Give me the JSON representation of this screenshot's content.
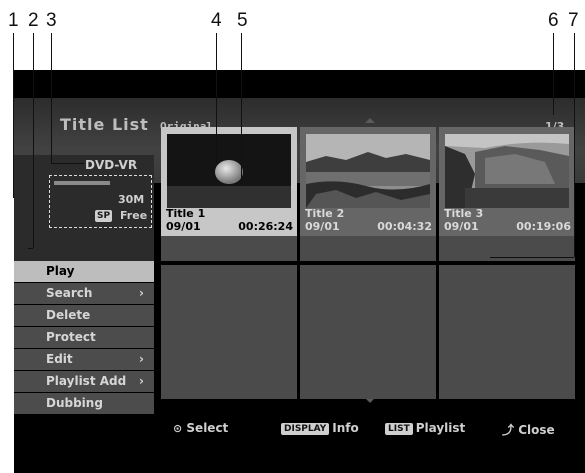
{
  "callouts": [
    "1",
    "2",
    "3",
    "4",
    "5",
    "6",
    "7"
  ],
  "header": {
    "title": "Title List",
    "mode": "Original",
    "page": "1/3"
  },
  "disc": {
    "type": "DVD-VR",
    "size": "30M",
    "sp_badge": "SP",
    "free": "Free"
  },
  "menu": {
    "items": [
      {
        "label": "Play",
        "active": true,
        "submenu": false
      },
      {
        "label": "Search",
        "active": false,
        "submenu": true
      },
      {
        "label": "Delete",
        "active": false,
        "submenu": false
      },
      {
        "label": "Protect",
        "active": false,
        "submenu": false
      },
      {
        "label": "Edit",
        "active": false,
        "submenu": true
      },
      {
        "label": "Playlist Add",
        "active": false,
        "submenu": true
      },
      {
        "label": "Dubbing",
        "active": false,
        "submenu": false
      }
    ],
    "submenu_arrow": "›"
  },
  "titles": [
    {
      "name": "Title 1",
      "date": "09/01",
      "duration": "00:26:24",
      "selected": true
    },
    {
      "name": "Title 2",
      "date": "09/01",
      "duration": "00:04:32",
      "selected": false
    },
    {
      "name": "Title 3",
      "date": "09/01",
      "duration": "00:19:06",
      "selected": false
    }
  ],
  "footer": {
    "select": "Select",
    "display_key": "DISPLAY",
    "info": "Info",
    "list_key": "LIST",
    "playlist": "Playlist",
    "close": "Close"
  },
  "colors": {
    "screen_bg": "#000000",
    "selected_bg": "#c7c7c7",
    "menu_bg": "#4c4c4c"
  }
}
